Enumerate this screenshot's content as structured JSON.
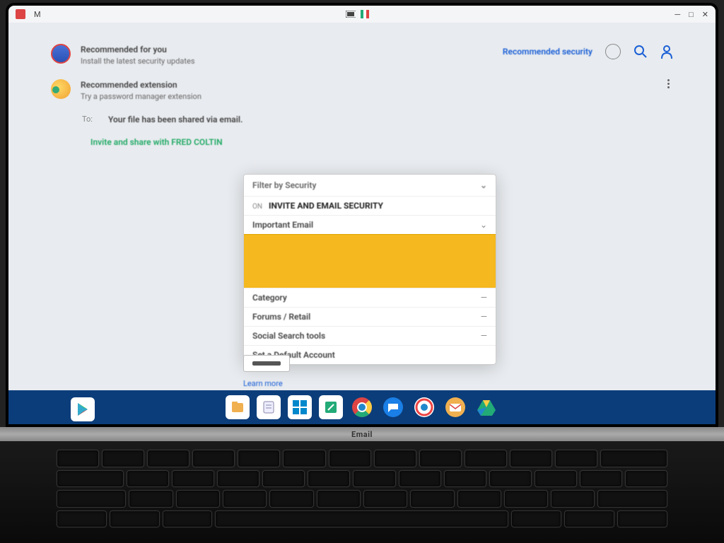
{
  "menubar": {
    "left_label": "M",
    "right_items": [
      "□",
      "✕"
    ]
  },
  "content": {
    "item1": {
      "title": "Recommended for you",
      "sub": "Install the latest security updates"
    },
    "item2": {
      "title": "Recommended extension",
      "sub": "Try a password manager extension"
    },
    "link_right": "Recommended security",
    "row3_label": "To:",
    "row3_text": "Your file has been shared via email.",
    "row4_text": "Invite and share with FRED COLTIN"
  },
  "panel": {
    "header": "Filter by Security",
    "row1_small": "ON",
    "row1_main": "INVITE AND EMAIL SECURITY",
    "row2": "Important Email",
    "rows": [
      "Category",
      "Forums / Retail",
      "Social Search tools",
      "Set a Default Account"
    ]
  },
  "below": {
    "link": "Learn more"
  },
  "hinge_brand": "Email",
  "colors": {
    "accent_yellow": "#f5b81e",
    "taskbar": "#0b3d7a",
    "link": "#1a5fd6"
  }
}
